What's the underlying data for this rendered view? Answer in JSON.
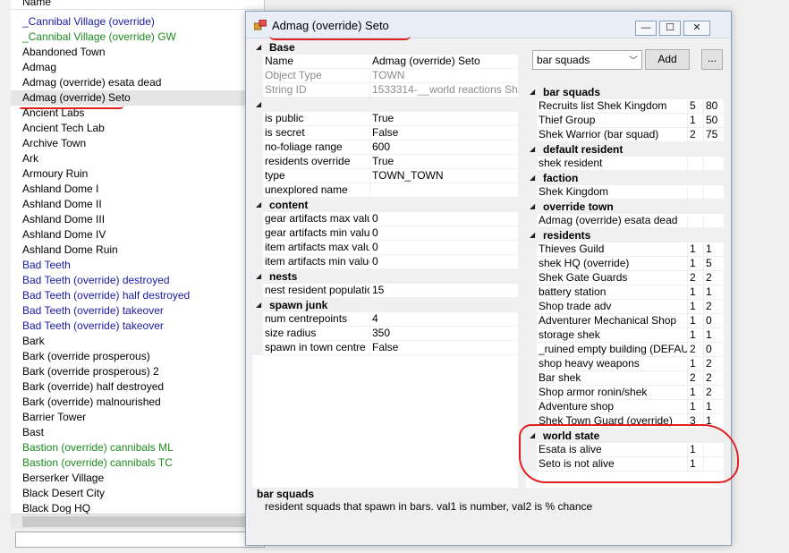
{
  "list": {
    "header": "Name",
    "items": [
      {
        "label": "_Cannibal Village (override)",
        "color": "blue"
      },
      {
        "label": "_Cannibal Village (override) GW",
        "color": "green"
      },
      {
        "label": "Abandoned Town",
        "color": "black"
      },
      {
        "label": "Admag",
        "color": "black"
      },
      {
        "label": "Admag (override) esata dead",
        "color": "black"
      },
      {
        "label": "Admag (override) Seto",
        "color": "black",
        "selected": true
      },
      {
        "label": "Ancient Labs",
        "color": "black"
      },
      {
        "label": "Ancient Tech Lab",
        "color": "black"
      },
      {
        "label": "Archive Town",
        "color": "black"
      },
      {
        "label": "Ark",
        "color": "black"
      },
      {
        "label": "Armoury Ruin",
        "color": "black"
      },
      {
        "label": "Ashland Dome I",
        "color": "black"
      },
      {
        "label": "Ashland Dome II",
        "color": "black"
      },
      {
        "label": "Ashland Dome III",
        "color": "black"
      },
      {
        "label": "Ashland Dome IV",
        "color": "black"
      },
      {
        "label": "Ashland Dome Ruin",
        "color": "black"
      },
      {
        "label": "Bad Teeth",
        "color": "blue"
      },
      {
        "label": "Bad Teeth (override) destroyed",
        "color": "blue"
      },
      {
        "label": "Bad Teeth (override) half destroyed",
        "color": "blue"
      },
      {
        "label": "Bad Teeth (override) takeover",
        "color": "blue"
      },
      {
        "label": "Bad Teeth (override) takeover",
        "color": "blue"
      },
      {
        "label": "Bark",
        "color": "black"
      },
      {
        "label": "Bark (override prosperous)",
        "color": "black"
      },
      {
        "label": "Bark (override prosperous) 2",
        "color": "black"
      },
      {
        "label": "Bark (override) half destroyed",
        "color": "black"
      },
      {
        "label": "Bark (override) malnourished",
        "color": "black"
      },
      {
        "label": "Barrier Tower",
        "color": "black"
      },
      {
        "label": "Bast",
        "color": "black"
      },
      {
        "label": "Bastion (override) cannibals ML",
        "color": "green"
      },
      {
        "label": "Bastion (override) cannibals TC",
        "color": "green"
      },
      {
        "label": "Berserker Village",
        "color": "black"
      },
      {
        "label": "Black Desert City",
        "color": "black"
      },
      {
        "label": "Black Dog HQ",
        "color": "black"
      }
    ]
  },
  "dialog": {
    "title": "Admag (override) Seto",
    "buttons": {
      "minimize": "—",
      "maximize": "☐",
      "close": "✕"
    },
    "properties": [
      {
        "category": "Base",
        "rows": [
          {
            "key": "Name",
            "value": "Admag (override) Seto",
            "readonly": false
          },
          {
            "key": "Object Type",
            "value": "TOWN",
            "readonly": true
          },
          {
            "key": "String ID",
            "value": "1533314-__world reactions Shek",
            "readonly": true
          }
        ]
      },
      {
        "category": "",
        "rows": [
          {
            "key": "is public",
            "value": "True"
          },
          {
            "key": "is secret",
            "value": "False"
          },
          {
            "key": "no-foliage range",
            "value": "600"
          },
          {
            "key": "residents override",
            "value": "True"
          },
          {
            "key": "type",
            "value": "TOWN_TOWN"
          },
          {
            "key": "unexplored name",
            "value": ""
          }
        ]
      },
      {
        "category": "content",
        "rows": [
          {
            "key": "gear artifacts max value",
            "value": "0"
          },
          {
            "key": "gear artifacts min value",
            "value": "0"
          },
          {
            "key": "item artifacts max value",
            "value": "0"
          },
          {
            "key": "item artifacts min value",
            "value": "0"
          }
        ]
      },
      {
        "category": "nests",
        "rows": [
          {
            "key": "nest resident population",
            "value": "15"
          }
        ]
      },
      {
        "category": "spawn junk",
        "rows": [
          {
            "key": "num centrepoints",
            "value": "4"
          },
          {
            "key": "size radius",
            "value": "350"
          },
          {
            "key": "spawn in town centre",
            "value": "False"
          }
        ]
      }
    ],
    "squad_select": {
      "value": "bar squads",
      "arrow": "﹀"
    },
    "add_button": "Add",
    "more_button": "...",
    "references": [
      {
        "category": "bar squads",
        "rows": [
          {
            "name": "Recruits list Shek Kingdom",
            "v1": "5",
            "v2": "80"
          },
          {
            "name": "Thief Group",
            "v1": "1",
            "v2": "50"
          },
          {
            "name": "Shek Warrior (bar squad)",
            "v1": "2",
            "v2": "75"
          }
        ]
      },
      {
        "category": "default resident",
        "rows": [
          {
            "name": "shek resident",
            "v1": "",
            "v2": ""
          }
        ]
      },
      {
        "category": "faction",
        "rows": [
          {
            "name": "Shek Kingdom",
            "v1": "",
            "v2": ""
          }
        ]
      },
      {
        "category": "override town",
        "rows": [
          {
            "name": "Admag (override) esata dead",
            "v1": "",
            "v2": ""
          }
        ]
      },
      {
        "category": "residents",
        "rows": [
          {
            "name": "Thieves Guild",
            "v1": "1",
            "v2": "1"
          },
          {
            "name": "shek HQ (override)",
            "v1": "1",
            "v2": "5"
          },
          {
            "name": "Shek Gate Guards",
            "v1": "2",
            "v2": "2"
          },
          {
            "name": "battery station",
            "v1": "1",
            "v2": "1"
          },
          {
            "name": "Shop trade adv",
            "v1": "1",
            "v2": "2"
          },
          {
            "name": "Adventurer Mechanical Shop",
            "v1": "1",
            "v2": "0"
          },
          {
            "name": "storage shek",
            "v1": "1",
            "v2": "1"
          },
          {
            "name": "_ruined empty building (DEFAULT)",
            "v1": "2",
            "v2": "0"
          },
          {
            "name": "shop heavy weapons",
            "v1": "1",
            "v2": "2"
          },
          {
            "name": "Bar shek",
            "v1": "2",
            "v2": "2"
          },
          {
            "name": "Shop armor ronin/shek",
            "v1": "1",
            "v2": "2"
          },
          {
            "name": "Adventure shop",
            "v1": "1",
            "v2": "1"
          },
          {
            "name": "Shek Town Guard (override)",
            "v1": "3",
            "v2": "1"
          }
        ]
      },
      {
        "category": "world state",
        "rows": [
          {
            "name": "Esata is alive",
            "v1": "1",
            "v2": ""
          },
          {
            "name": "Seto is not alive",
            "v1": "1",
            "v2": ""
          }
        ]
      }
    ],
    "description": {
      "title": "bar squads",
      "text": "resident squads that spawn in bars. val1 is number, val2 is % chance"
    }
  },
  "colors": {
    "blue": "#1a1aa6",
    "green": "#1e8a1e",
    "annotation": "#e02020"
  }
}
